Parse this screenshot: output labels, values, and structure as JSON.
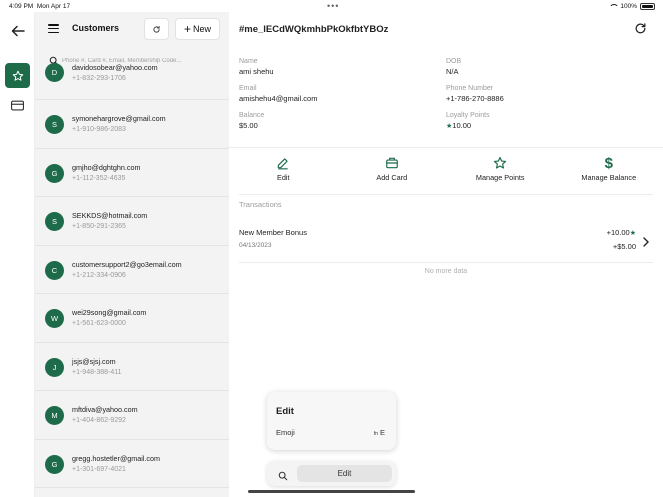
{
  "status": {
    "time": "4:09 PM",
    "date": "Mon Apr 17",
    "battery": "100%"
  },
  "list": {
    "title": "Customers",
    "new_label": "New",
    "search_placeholder": "Phone #, Card #, Email, Membership Code...",
    "rows": [
      {
        "initial": "D",
        "email": "davidosobear@yahoo.com",
        "phone": "+1-832-293-1706"
      },
      {
        "initial": "S",
        "email": "symonehargrove@gmail.com",
        "phone": "+1-910-986-2083"
      },
      {
        "initial": "G",
        "email": "gmjho@dghtghn.com",
        "phone": "+1-112-352-4635"
      },
      {
        "initial": "S",
        "email": "SEKKDS@hotmail.com",
        "phone": "+1-850-291-2365"
      },
      {
        "initial": "C",
        "email": "customersupport2@go3email.com",
        "phone": "+1-212-334-0906"
      },
      {
        "initial": "W",
        "email": "wei29song@gmail.com",
        "phone": "+1-561-623-0000"
      },
      {
        "initial": "J",
        "email": "jsjs@sjsj.com",
        "phone": "+1-948-388-411"
      },
      {
        "initial": "M",
        "email": "mftdiva@yahoo.com",
        "phone": "+1-404-862-9292"
      },
      {
        "initial": "G",
        "email": "gregg.hostetler@gmail.com",
        "phone": "+1-301-697-4021"
      }
    ]
  },
  "detail": {
    "title": "#me_lECdWQkmhbPkOkfbtYBOz",
    "fields": {
      "name_label": "Name",
      "name": "ami shehu",
      "dob_label": "DOB",
      "dob": "N/A",
      "email_label": "Email",
      "email": "amishehu4@gmail.com",
      "phone_label": "Phone Number",
      "phone": "+1-786-270-8886",
      "balance_label": "Balance",
      "balance": "$5.00",
      "loyalty_label": "Loyalty Points",
      "loyalty": "10.00"
    },
    "actions": {
      "edit": "Edit",
      "add_card": "Add Card",
      "manage_points": "Manage Points",
      "manage_balance": "Manage Balance"
    },
    "transactions_title": "Transactions",
    "transaction": {
      "name": "New Member Bonus",
      "date": "04/13/2023",
      "points": "+10.00",
      "amount": "+$5.00"
    },
    "no_more": "No more data"
  },
  "popover": {
    "title": "Edit",
    "item": "Emoji",
    "shortcut_mod": "fn",
    "shortcut_key": "E"
  },
  "shortcut_bar": {
    "edit": "Edit"
  },
  "colors": {
    "accent": "#1e6b4a"
  }
}
